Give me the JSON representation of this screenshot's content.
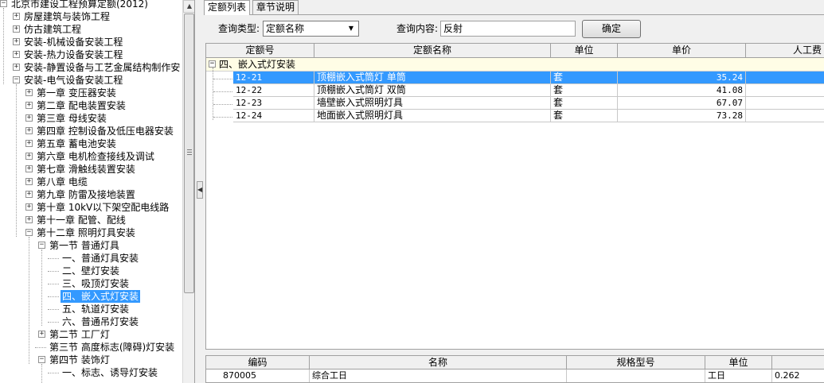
{
  "tree": {
    "items": [
      {
        "expander": "−",
        "label": "北京市建设工程预算定额(2012)"
      },
      {
        "expander": "+",
        "label": "房屋建筑与装饰工程"
      },
      {
        "expander": "+",
        "label": "仿古建筑工程"
      },
      {
        "expander": "+",
        "label": "安装-机械设备安装工程"
      },
      {
        "expander": "+",
        "label": "安装-热力设备安装工程"
      },
      {
        "expander": "+",
        "label": "安装-静置设备与工艺金属结构制作安"
      },
      {
        "expander": "−",
        "label": "安装-电气设备安装工程"
      },
      {
        "expander": "+",
        "label": "第一章  变压器安装"
      },
      {
        "expander": "+",
        "label": "第二章  配电装置安装"
      },
      {
        "expander": "+",
        "label": "第三章  母线安装"
      },
      {
        "expander": "+",
        "label": "第四章  控制设备及低压电器安装"
      },
      {
        "expander": "+",
        "label": "第五章  蓄电池安装"
      },
      {
        "expander": "+",
        "label": "第六章  电机检查接线及调试"
      },
      {
        "expander": "+",
        "label": "第七章  滑触线装置安装"
      },
      {
        "expander": "+",
        "label": "第八章  电缆"
      },
      {
        "expander": "+",
        "label": "第九章  防雷及接地装置"
      },
      {
        "expander": "+",
        "label": "第十章  10kV以下架空配电线路"
      },
      {
        "expander": "+",
        "label": "第十一章  配管、配线"
      },
      {
        "expander": "−",
        "label": "第十二章  照明灯具安装"
      },
      {
        "expander": "−",
        "label": "第一节  普通灯具"
      },
      {
        "expander": "",
        "label": "一、普通灯具安装"
      },
      {
        "expander": "",
        "label": "二、壁灯安装"
      },
      {
        "expander": "",
        "label": "三、吸顶灯安装"
      },
      {
        "expander": "",
        "label": "四、嵌入式灯安装"
      },
      {
        "expander": "",
        "label": "五、轨道灯安装"
      },
      {
        "expander": "",
        "label": "六、普通吊灯安装"
      },
      {
        "expander": "+",
        "label": "第二节  工厂灯"
      },
      {
        "expander": "",
        "label": "第三节  高度标志(障碍)灯安装"
      },
      {
        "expander": "−",
        "label": "第四节  装饰灯"
      },
      {
        "expander": "",
        "label": "一、标志、诱导灯安装"
      }
    ]
  },
  "tabs": [
    {
      "label": "定额列表"
    },
    {
      "label": "章节说明"
    }
  ],
  "query": {
    "type_label": "查询类型:",
    "type_value": "定额名称",
    "content_label": "查询内容:",
    "content_value": "反射",
    "confirm_label": "确定"
  },
  "grid": {
    "columns": [
      "定额号",
      "定额名称",
      "单位",
      "单价",
      "人工费"
    ],
    "group_label": "四、嵌入式灯安装",
    "rows": [
      {
        "code": "12-21",
        "name": "顶棚嵌入式筒灯 单筒",
        "unit": "套",
        "price": "35.24"
      },
      {
        "code": "12-22",
        "name": "顶棚嵌入式筒灯 双筒",
        "unit": "套",
        "price": "41.08"
      },
      {
        "code": "12-23",
        "name": "墙壁嵌入式照明灯具",
        "unit": "套",
        "price": "67.07"
      },
      {
        "code": "12-24",
        "name": "地面嵌入式照明灯具",
        "unit": "套",
        "price": "73.28"
      }
    ]
  },
  "resource_grid": {
    "columns": [
      "编码",
      "名称",
      "规格型号",
      "单位",
      ""
    ],
    "rows": [
      {
        "code": "870005",
        "name": "综合工日",
        "spec": "",
        "unit": "工日",
        "qty": "0.262"
      }
    ]
  },
  "colors": {
    "selection": "#3399ff",
    "group_row_bg": "#fffde6"
  }
}
